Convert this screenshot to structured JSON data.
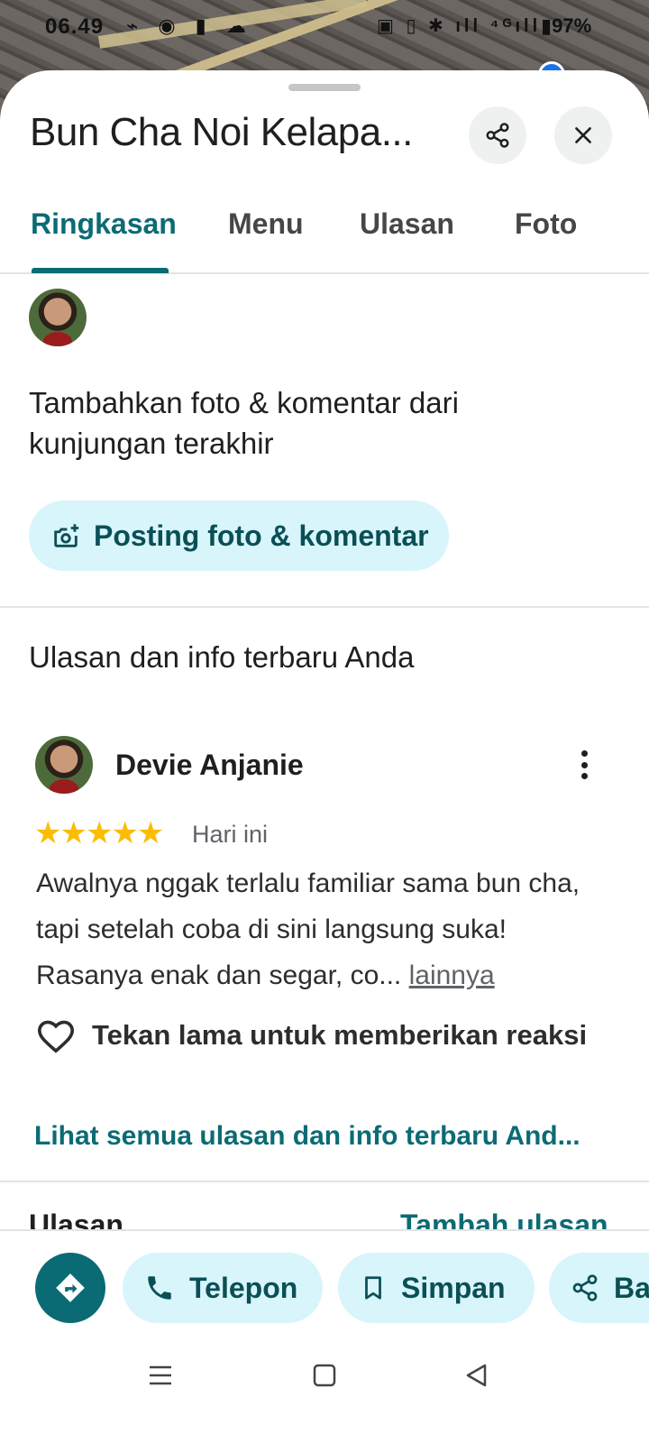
{
  "status_bar": {
    "time": "06.49",
    "left_icons": "⌁ ◉ ▮ ☁",
    "right_icons": "▣ ▯ ✱ ıll ⁴ᴳıll",
    "battery": "97%"
  },
  "place": {
    "title": "Bun Cha Noi Kelapa..."
  },
  "tabs": [
    {
      "label": "Ringkasan",
      "active": true
    },
    {
      "label": "Menu",
      "active": false
    },
    {
      "label": "Ulasan",
      "active": false
    },
    {
      "label": "Foto",
      "active": false
    }
  ],
  "add_prompt": {
    "text": "Tambahkan foto & komentar dari kunjungan terakhir",
    "button_label": "Posting foto & komentar"
  },
  "your_reviews": {
    "section_title": "Ulasan dan info terbaru Anda",
    "review": {
      "author": "Devie Anjanie",
      "rating": 5,
      "stars": "★★★★★",
      "date": "Hari ini",
      "text": "Awalnya nggak terlalu familiar sama bun cha, tapi setelah coba di sini langsung suka! Rasanya enak dan segar, co...",
      "more_label": "lainnya",
      "reaction_hint": "Tekan lama untuk memberikan reaksi"
    },
    "see_all_label": "Lihat semua ulasan dan info terbaru And..."
  },
  "next_section": {
    "title": "Ulasan",
    "action": "Tambah ulasan"
  },
  "actions": {
    "call_label": "Telepon",
    "save_label": "Simpan",
    "share_label": "Bagikan"
  },
  "colors": {
    "accent": "#0b6b74",
    "pill_bg": "#d7f5fb",
    "star": "#fbbc04"
  }
}
